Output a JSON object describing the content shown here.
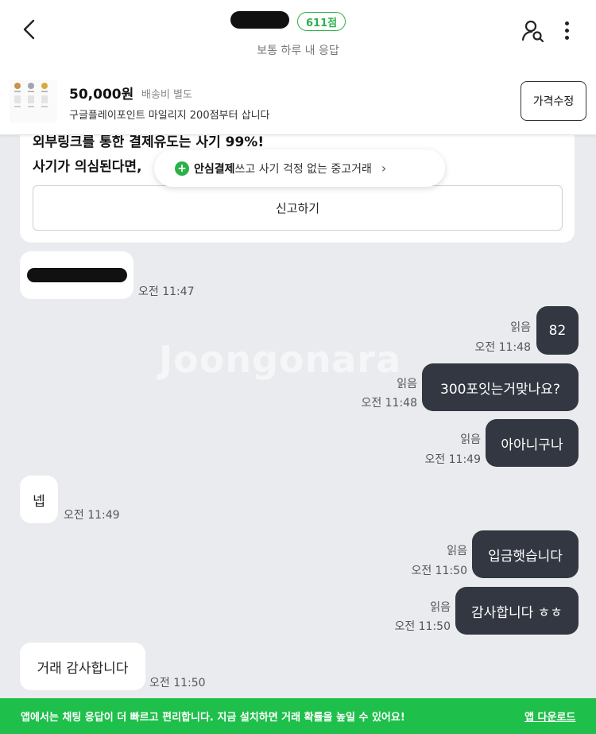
{
  "header": {
    "score_badge": "611점",
    "response_status": "보통 하루 내 응답"
  },
  "product": {
    "price": "50,000원",
    "shipping": "배송비 별도",
    "description": "구글플레이포인트 마일리지 200점부터 삽니다",
    "edit_price_label": "가격수정"
  },
  "warning": {
    "line1": "외부링크를 통한 결제유도는 사기 99%!",
    "line2": "사기가 의심된다면,",
    "report_label": "신고하기"
  },
  "safe_pay": {
    "bold": "안심결제",
    "text": "쓰고 사기 걱정 없는 중고거래",
    "chevron": "›"
  },
  "watermark": "Joongonara",
  "messages": [
    {
      "side": "in",
      "text": "",
      "redacted": true,
      "time": "오전 11:47"
    },
    {
      "side": "out",
      "text": "82",
      "read": "읽음",
      "time": "오전 11:48"
    },
    {
      "side": "out",
      "text": "300포잇는거맞나요?",
      "read": "읽음",
      "time": "오전 11:48"
    },
    {
      "side": "out",
      "text": "아아니구나",
      "read": "읽음",
      "time": "오전 11:49"
    },
    {
      "side": "in",
      "text": "넵",
      "time": "오전 11:49"
    },
    {
      "side": "out",
      "text": "입금햇습니다",
      "read": "읽음",
      "time": "오전 11:50"
    },
    {
      "side": "out",
      "text": "감사합니다 ㅎㅎ",
      "read": "읽음",
      "time": "오전 11:50"
    },
    {
      "side": "in",
      "text": "거래 감사합니다",
      "time": "오전 11:50"
    }
  ],
  "banner": {
    "text": "앱에서는 채팅 응답이 더 빠르고 편리합니다. 지금 설치하면 거래 확률을 높일 수 있어요!",
    "link": "앱 다운로드"
  },
  "colors": {
    "accent_green": "#2bb04a",
    "banner_green": "#1fbf4b",
    "bubble_out": "#323741",
    "chat_bg": "#e9ebee"
  }
}
